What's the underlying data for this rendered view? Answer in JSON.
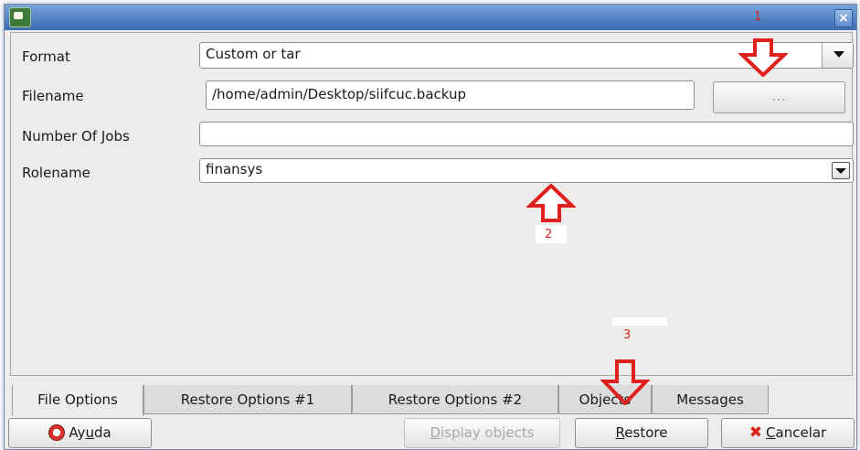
{
  "window": {
    "close_glyph": "×"
  },
  "annotations": {
    "marker_1": "1",
    "marker_2": "2",
    "marker_3": "3",
    "arrow_color": "#e0201c"
  },
  "form": {
    "format": {
      "label": "Format",
      "value": "Custom or tar"
    },
    "filename": {
      "label": "Filename",
      "value": "/home/admin/Desktop/siifcuc.backup",
      "browse_label": "..."
    },
    "jobs": {
      "label": "Number Of Jobs",
      "value": ""
    },
    "rolename": {
      "label": "Rolename",
      "value": "finansys"
    }
  },
  "tabs": [
    {
      "label": "File Options",
      "active": true
    },
    {
      "label": "Restore Options #1"
    },
    {
      "label": "Restore Options #2"
    },
    {
      "label": "Objects"
    },
    {
      "label": "Messages"
    }
  ],
  "buttons": {
    "help": {
      "prefix": "Ay",
      "accel": "u",
      "suffix": "da",
      "icon": "lifebuoy-icon"
    },
    "display_objects": {
      "prefix": "",
      "accel": "D",
      "suffix": "isplay objects"
    },
    "restore": {
      "prefix": "",
      "accel": "R",
      "suffix": "estore"
    },
    "cancel": {
      "prefix": "",
      "accel": "C",
      "suffix": "ancelar",
      "icon": "x-icon"
    }
  }
}
